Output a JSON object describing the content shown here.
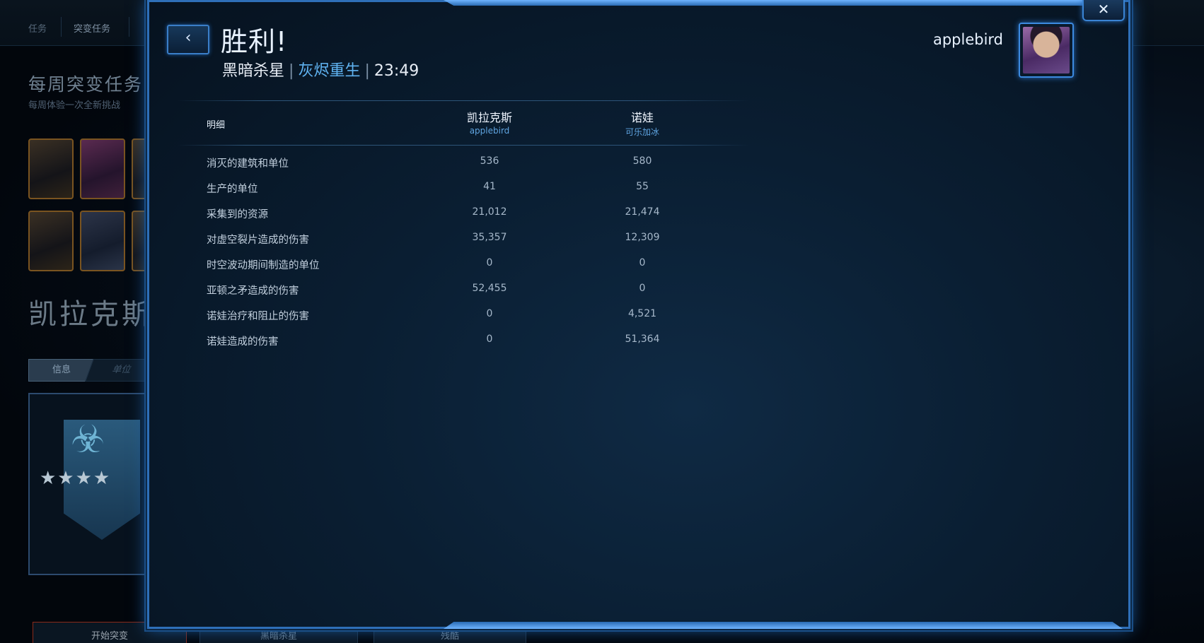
{
  "background": {
    "nav_tabs": [
      "任务",
      "突变任务"
    ],
    "heading": "每周突变任务",
    "subheading": "每周体验一次全新挑战",
    "commander_title": "凯拉克斯",
    "tab_info": "信息",
    "tab_units": "单位",
    "bottom_buttons": [
      "开始突变",
      "黑暗杀星",
      "残酷"
    ]
  },
  "dialog": {
    "close_glyph": "✕",
    "back_glyph": "‹",
    "result_title": "胜利!",
    "map_name": "黑暗杀星",
    "separator": "|",
    "mutation_name": "灰烬重生",
    "duration": "23:49",
    "player_name": "applebird"
  },
  "stats": {
    "label_header": "明细",
    "columns": [
      {
        "commander": "凯拉克斯",
        "player": "applebird"
      },
      {
        "commander": "诺娃",
        "player": "可乐加冰"
      }
    ],
    "rows": [
      {
        "label": "消灭的建筑和单位",
        "v1": "536",
        "v2": "580"
      },
      {
        "label": "生产的单位",
        "v1": "41",
        "v2": "55"
      },
      {
        "label": "采集到的资源",
        "v1": "21,012",
        "v2": "21,474"
      },
      {
        "label": "对虚空裂片造成的伤害",
        "v1": "35,357",
        "v2": "12,309"
      },
      {
        "label": "时空波动期间制造的单位",
        "v1": "0",
        "v2": "0"
      },
      {
        "label": "亚顿之矛造成的伤害",
        "v1": "52,455",
        "v2": "0"
      },
      {
        "label": "诺娃治疗和阻止的伤害",
        "v1": "0",
        "v2": "4,521"
      },
      {
        "label": "诺娃造成的伤害",
        "v1": "0",
        "v2": "51,364"
      }
    ]
  }
}
